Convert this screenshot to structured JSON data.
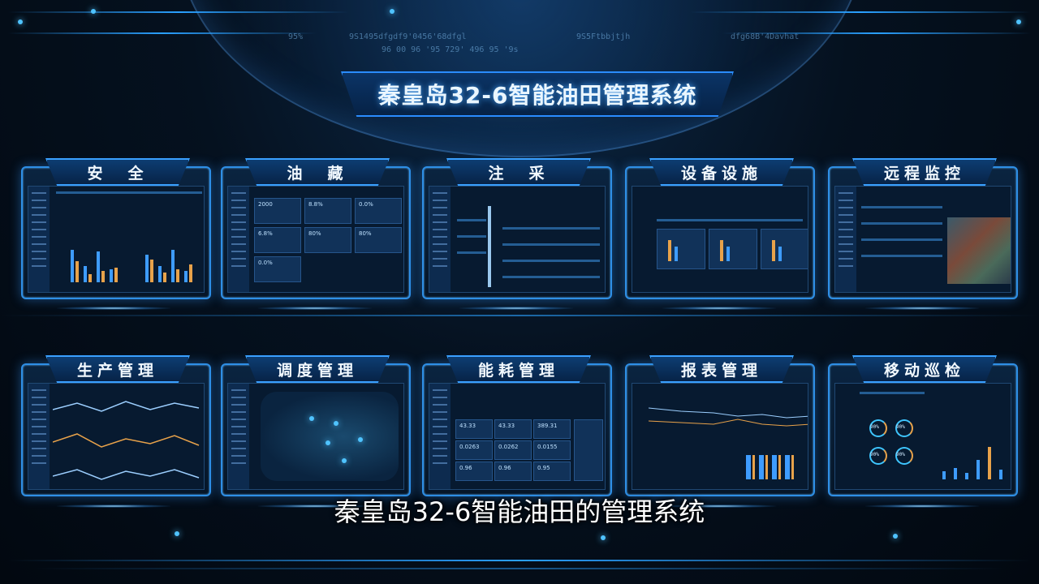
{
  "header": {
    "title": "秦皇岛32-6智能油田管理系统",
    "hud_codes": [
      "95%",
      "9S1495dfgdf9'0456'68dfgl",
      "9S5Ftbbjtjh",
      "dfg68B'4Davhat",
      "96 00 96 '95 729' 496 95 '9s"
    ]
  },
  "modules": [
    {
      "label": "安　全",
      "key": "safety"
    },
    {
      "label": "油　藏",
      "key": "reservoir"
    },
    {
      "label": "注　采",
      "key": "injection"
    },
    {
      "label": "设备设施",
      "key": "equipment"
    },
    {
      "label": "远程监控",
      "key": "remote"
    },
    {
      "label": "生产管理",
      "key": "production"
    },
    {
      "label": "调度管理",
      "key": "dispatch"
    },
    {
      "label": "能耗管理",
      "key": "energy"
    },
    {
      "label": "报表管理",
      "key": "report"
    },
    {
      "label": "移动巡检",
      "key": "inspection"
    }
  ],
  "reservoir_values": [
    "2000",
    "8.8%",
    "0.0%",
    "6.8%",
    "80%",
    "80%",
    "0.0%"
  ],
  "energy_values": [
    "43.33",
    "43.33",
    "389.31",
    "0.0263",
    "0.0262",
    "0.0155",
    "0.96",
    "0.96",
    "0.95"
  ],
  "inspection_values": [
    "90%",
    "90%",
    "90%",
    "90%"
  ],
  "subtitle": "秦皇岛32-6智能油田的管理系统",
  "colors": {
    "accent": "#2e8fe6",
    "bar_orange": "#e8a24a",
    "bar_blue": "#3e9cff"
  }
}
